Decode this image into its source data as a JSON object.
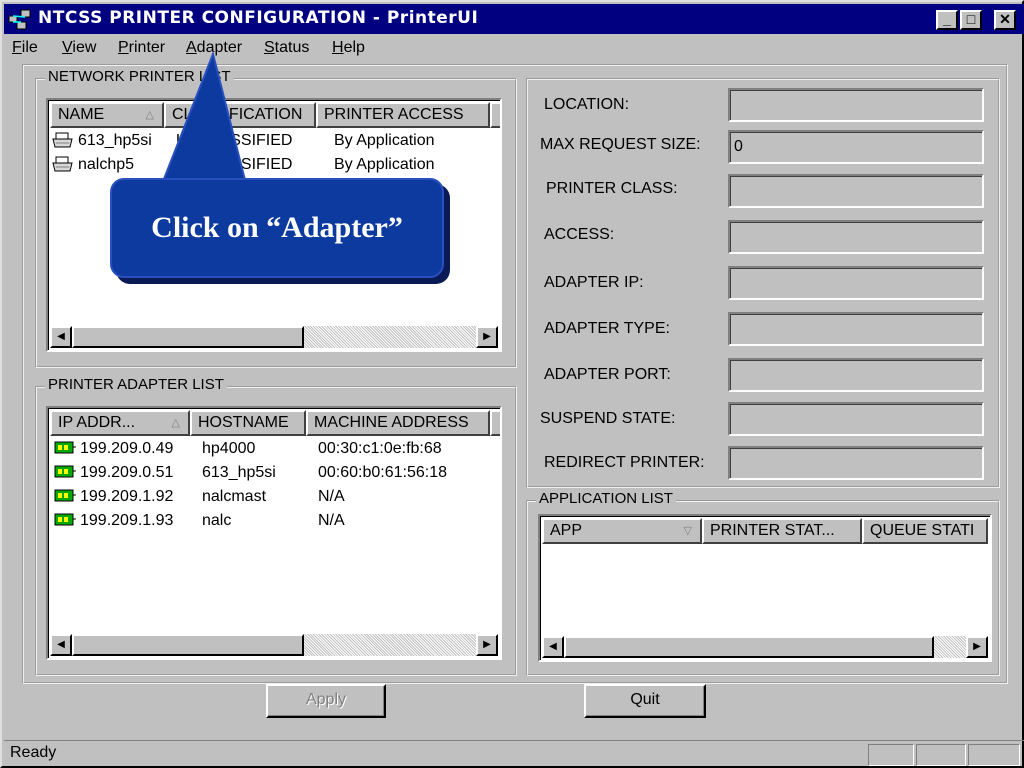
{
  "window": {
    "title": "NTCSS PRINTER CONFIGURATION - PrinterUI",
    "controls": {
      "minimize": "_",
      "maximize": "□",
      "close": "✕"
    }
  },
  "menubar": {
    "items": [
      {
        "pre": "",
        "ul": "F",
        "post": "ile"
      },
      {
        "pre": "",
        "ul": "V",
        "post": "iew"
      },
      {
        "pre": "",
        "ul": "P",
        "post": "rinter"
      },
      {
        "pre": "",
        "ul": "A",
        "post": "dapter"
      },
      {
        "pre": "",
        "ul": "S",
        "post": "tatus"
      },
      {
        "pre": "",
        "ul": "H",
        "post": "elp"
      }
    ]
  },
  "network_printer_list": {
    "label": "NETWORK PRINTER LIST",
    "columns": [
      "NAME",
      "CLASSIFICATION",
      "PRINTER ACCESS"
    ],
    "rows": [
      {
        "name": "613_hp5si",
        "classification": "UNCLASSIFIED",
        "access": "By Application"
      },
      {
        "name": "nalchp5",
        "classification": "UNCLASSIFIED",
        "access": "By Application"
      }
    ]
  },
  "printer_adapter_list": {
    "label": "PRINTER ADAPTER LIST",
    "columns": [
      "IP ADDR...",
      "HOSTNAME",
      "MACHINE ADDRESS"
    ],
    "rows": [
      {
        "ip": "199.209.0.49",
        "host": "hp4000",
        "mac": "00:30:c1:0e:fb:68"
      },
      {
        "ip": "199.209.0.51",
        "host": "613_hp5si",
        "mac": "00:60:b0:61:56:18"
      },
      {
        "ip": "199.209.1.92",
        "host": "nalcmast",
        "mac": "N/A"
      },
      {
        "ip": "199.209.1.93",
        "host": "nalc",
        "mac": "N/A"
      }
    ]
  },
  "details": {
    "location": {
      "label": "LOCATION:",
      "value": ""
    },
    "max_request_size": {
      "label": "MAX REQUEST SIZE:",
      "value": "0"
    },
    "printer_class": {
      "label": "PRINTER CLASS:",
      "value": ""
    },
    "access": {
      "label": "ACCESS:",
      "value": ""
    },
    "adapter_ip": {
      "label": "ADAPTER IP:",
      "value": ""
    },
    "adapter_type": {
      "label": "ADAPTER TYPE:",
      "value": ""
    },
    "adapter_port": {
      "label": "ADAPTER PORT:",
      "value": ""
    },
    "suspend_state": {
      "label": "SUSPEND STATE:",
      "value": ""
    },
    "redirect_printer": {
      "label": "REDIRECT PRINTER:",
      "value": ""
    }
  },
  "application_list": {
    "label": "APPLICATION LIST",
    "columns": [
      "APP",
      "PRINTER STAT...",
      "QUEUE STATI"
    ]
  },
  "buttons": {
    "apply": "Apply",
    "quit": "Quit"
  },
  "statusbar": {
    "text": "Ready"
  },
  "callout": {
    "text": "Click on “Adapter”"
  },
  "colors": {
    "titlebar": "#000080",
    "face": "#c0c0c0",
    "callout": "#0d3a9e"
  },
  "icons": [
    "app-icon",
    "printer-icon",
    "adapter-icon",
    "sort-up-icon",
    "sort-down-icon",
    "scroll-left-icon",
    "scroll-right-icon"
  ]
}
